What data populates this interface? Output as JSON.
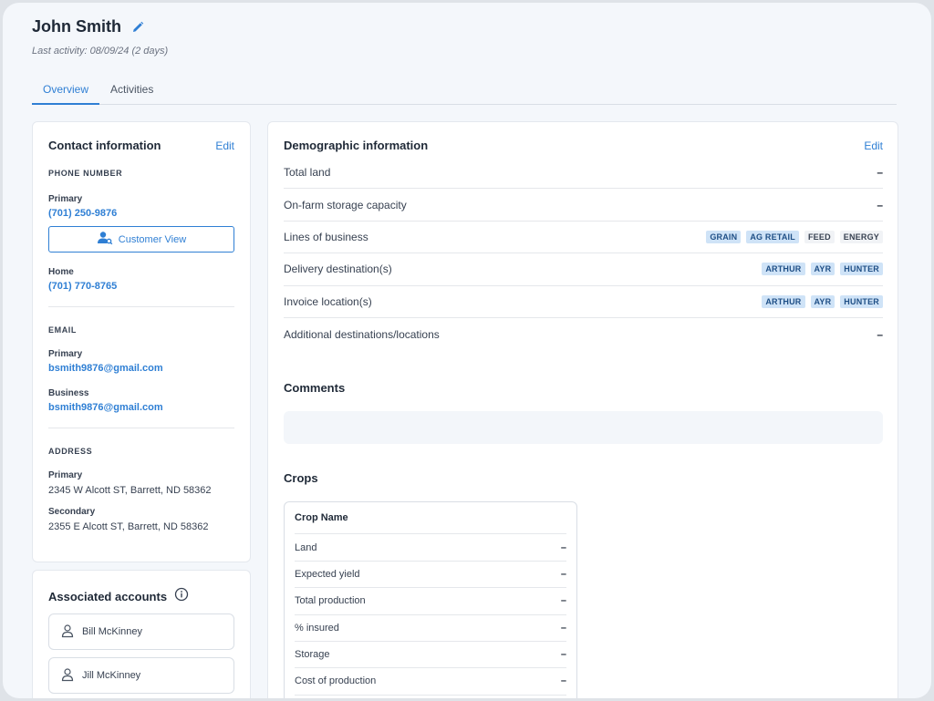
{
  "header": {
    "name": "John Smith",
    "last_activity": "Last activity: 08/09/24 (2 days)"
  },
  "tabs": [
    {
      "label": "Overview",
      "active": true
    },
    {
      "label": "Activities",
      "active": false
    }
  ],
  "contact": {
    "title": "Contact information",
    "edit_label": "Edit",
    "phone_section": "PHONE NUMBER",
    "phone_primary_label": "Primary",
    "phone_primary": "(701) 250-9876",
    "customer_view_label": "Customer View",
    "phone_home_label": "Home",
    "phone_home": "(701) 770-8765",
    "email_section": "EMAIL",
    "email_primary_label": "Primary",
    "email_primary": "bsmith9876@gmail.com",
    "email_business_label": "Business",
    "email_business": "bsmith9876@gmail.com",
    "address_section": "ADDRESS",
    "address_primary_label": "Primary",
    "address_primary": "2345 W Alcott ST, Barrett, ND 58362",
    "address_secondary_label": "Secondary",
    "address_secondary": "2355 E Alcott ST, Barrett, ND 58362"
  },
  "associated": {
    "title": "Associated accounts",
    "accounts": [
      "Bill McKinney",
      "Jill McKinney"
    ]
  },
  "demographic": {
    "title": "Demographic information",
    "edit_label": "Edit",
    "total_land_label": "Total land",
    "total_land_value": "–",
    "storage_label": "On-farm storage capacity",
    "storage_value": "–",
    "lines_label": "Lines of business",
    "lines_tags": [
      "GRAIN",
      "AG RETAIL",
      "FEED",
      "ENERGY"
    ],
    "delivery_label": "Delivery destination(s)",
    "delivery_tags": [
      "ARTHUR",
      "AYR",
      "HUNTER"
    ],
    "invoice_label": "Invoice location(s)",
    "invoice_tags": [
      "ARTHUR",
      "AYR",
      "HUNTER"
    ],
    "additional_label": "Additional destinations/locations",
    "additional_value": "–"
  },
  "comments": {
    "title": "Comments"
  },
  "crops": {
    "title": "Crops",
    "header": "Crop Name",
    "rows": [
      {
        "label": "Land",
        "value": "–"
      },
      {
        "label": "Expected yield",
        "value": "–"
      },
      {
        "label": "Total production",
        "value": "–"
      },
      {
        "label": "% insured",
        "value": "–"
      },
      {
        "label": "Storage",
        "value": "–"
      },
      {
        "label": "Cost of production",
        "value": "–"
      }
    ]
  },
  "colors": {
    "accent": "#2f7fd4",
    "tag_highlight_bg": "#cfe3f7",
    "tag_highlight_text": "#1f4f86",
    "tag_plain_bg": "#f1f3f6"
  }
}
